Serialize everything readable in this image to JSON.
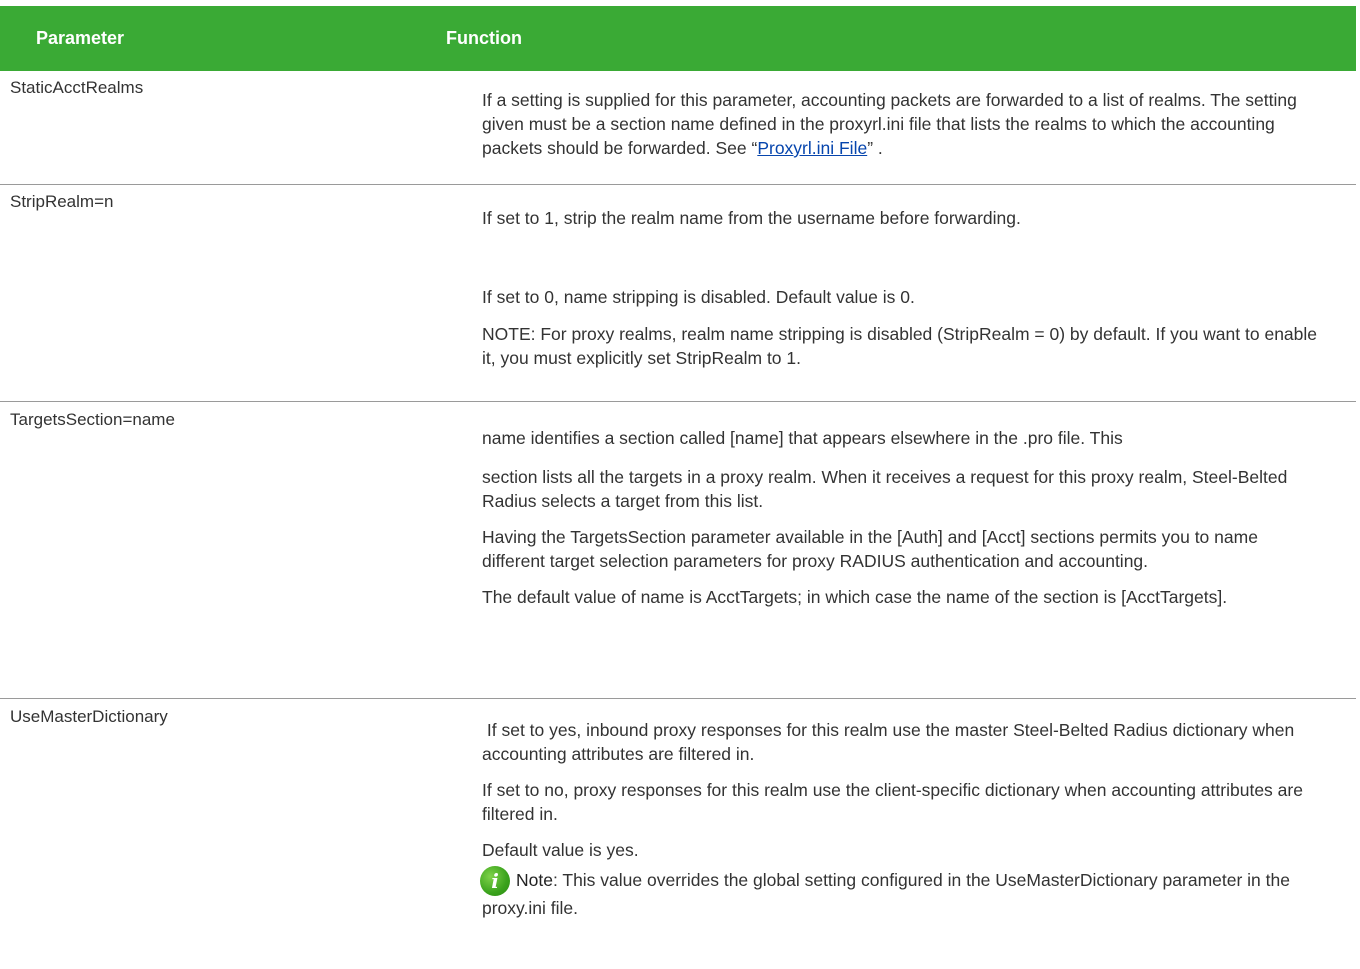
{
  "header": {
    "parameter": "Parameter",
    "function": "Function"
  },
  "rows": [
    {
      "param": "StaticAcctRealms",
      "p1_before": "If a setting is supplied for this parameter, accounting packets are forwarded to a list of realms. The setting given must be a section name defined in the proxyrl.ini file that lists the realms to which the accounting packets should be forwarded. See “",
      "p1_link": "Proxyrl.ini File",
      "p1_after": "” ."
    },
    {
      "param": "StripRealm=n",
      "p1": "If set to 1, strip the realm name from the username before forwarding.",
      "p2": "If set to 0, name stripping is disabled. Default value is 0.",
      "p3": "NOTE: For proxy realms, realm name stripping is disabled (StripRealm = 0) by default. If you want to enable it, you must explicitly set StripRealm to 1."
    },
    {
      "param": "TargetsSection=name",
      "p1": "name identifies a section called [name] that appears elsewhere in the .pro file. This",
      "p2": "section lists all the targets in a proxy realm. When it receives a request for this proxy realm, Steel-Belted Radius selects a target from this list.",
      "p3": "Having the TargetsSection parameter available in the [Auth] and [Acct] sections permits you to name different target selection parameters for proxy RADIUS authentication and accounting.",
      "p4": "The default value of name is AcctTargets; in which case the name of the section is [AcctTargets]."
    },
    {
      "param": "UseMasterDictionary",
      "p1": " If set to yes, inbound proxy responses for this realm use the master Steel-Belted Radius dictionary when accounting attributes are filtered in.",
      "p2": "If set to no, proxy responses for this realm use the client-specific dictionary when accounting attributes are filtered in.",
      "p3": "Default value is yes.",
      "note_icon": "info-icon",
      "note_label": "Note",
      "note_text": ": This value overrides the global setting configured in the UseMasterDictionary parameter in the proxy.ini file."
    }
  ]
}
